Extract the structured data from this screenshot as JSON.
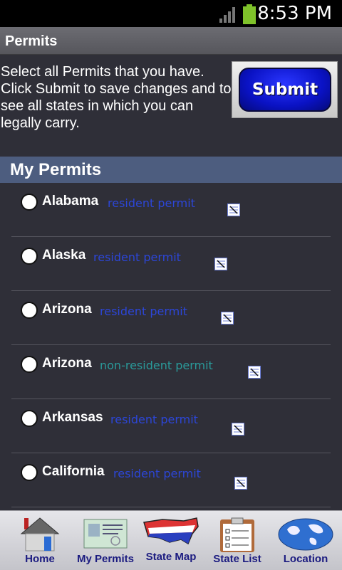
{
  "status": {
    "time": "8:53 PM"
  },
  "title": "Permits",
  "intro": {
    "text": "Select all Permits that you have. Click Submit to save changes and to see all states in which you can legally carry.",
    "submit_label": "Submit"
  },
  "section_title": "My Permits",
  "permits": [
    {
      "state": "Alabama",
      "type": "resident permit"
    },
    {
      "state": "Alaska",
      "type": "resident permit"
    },
    {
      "state": "Arizona",
      "type": "resident permit"
    },
    {
      "state": "Arizona",
      "type": "non-resident permit"
    },
    {
      "state": "Arkansas",
      "type": "resident permit"
    },
    {
      "state": "California",
      "type": "resident permit"
    }
  ],
  "tabs": [
    {
      "label": "Home",
      "icon": "home-icon"
    },
    {
      "label": "My Permits",
      "icon": "permits-icon"
    },
    {
      "label": "State Map",
      "icon": "usa-map-icon"
    },
    {
      "label": "State List",
      "icon": "state-list-icon"
    },
    {
      "label": "Location",
      "icon": "globe-icon"
    }
  ],
  "colors": {
    "resident": "#2c46d8",
    "non_resident": "#2a9a9a",
    "section_header": "#4d5d7f",
    "submit": "#0a12c4"
  }
}
